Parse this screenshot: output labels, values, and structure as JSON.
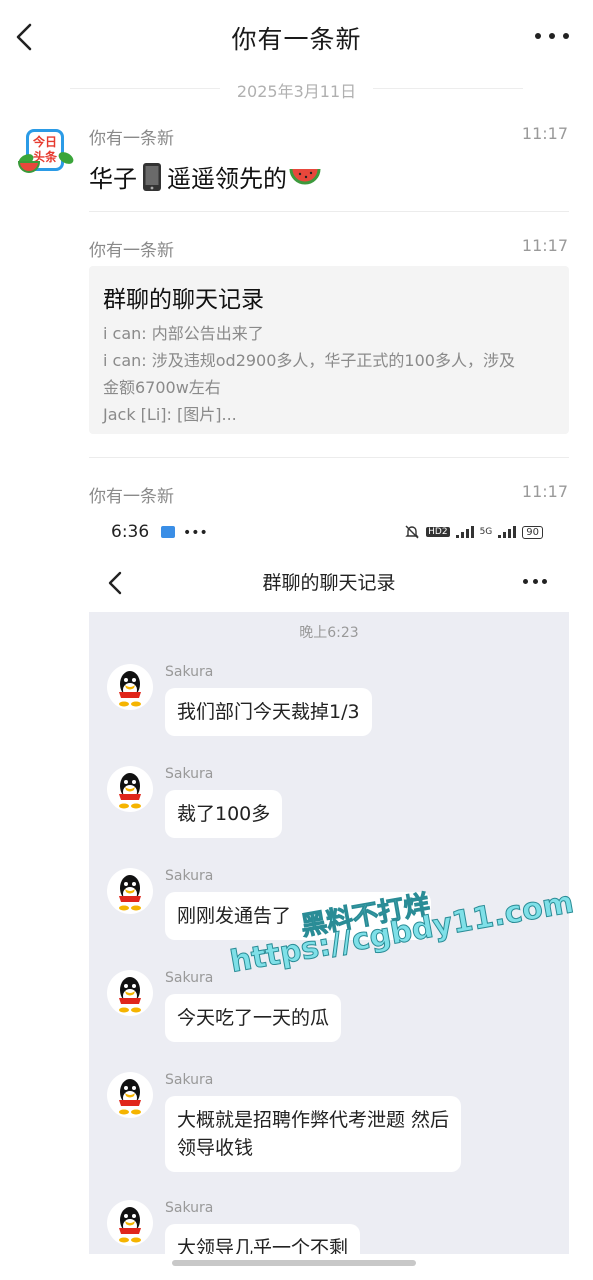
{
  "header": {
    "title": "你有一条新",
    "date": "2025年3月11日"
  },
  "app_avatar": {
    "line1": "今日",
    "line2": "头条"
  },
  "messages": [
    {
      "sender": "你有一条新",
      "time": "11:17",
      "text": "华子",
      "text2": "遥遥领先的"
    },
    {
      "sender": "你有一条新",
      "time": "11:17"
    },
    {
      "sender": "你有一条新",
      "time": "11:17"
    }
  ],
  "card": {
    "title": "群聊的聊天记录",
    "lines": [
      "i can: 内部公告出来了",
      "i can: 涉及违规od2900多人，华子正式的100多人，涉及",
      "金额6700w左右",
      "Jack [Li]: [图片]..."
    ]
  },
  "embedded": {
    "status_time": "6:36",
    "status_signal": "HD2",
    "status_5g": "5G",
    "battery": "90",
    "title": "群聊的聊天记录",
    "timestamp": "晚上6:23",
    "chats": [
      {
        "name": "Sakura",
        "text": "我们部门今天裁掉1/3"
      },
      {
        "name": "Sakura",
        "text": "裁了100多"
      },
      {
        "name": "Sakura",
        "text": "刚刚发通告了"
      },
      {
        "name": "Sakura",
        "text": "今天吃了一天的瓜"
      },
      {
        "name": "Sakura",
        "text": "大概就是招聘作弊代考泄题 然后",
        "text2": "领导收钱"
      },
      {
        "name": "Sakura",
        "text": "大领导几乎一个不剩"
      }
    ]
  },
  "watermark": {
    "line1": "黑料不打烊",
    "line2": "https://cgbdy11.com"
  },
  "colors": {
    "watermark": "#7fe0e8",
    "card_bg": "#f4f4f4",
    "embedded_bg": "#ecedf3"
  }
}
